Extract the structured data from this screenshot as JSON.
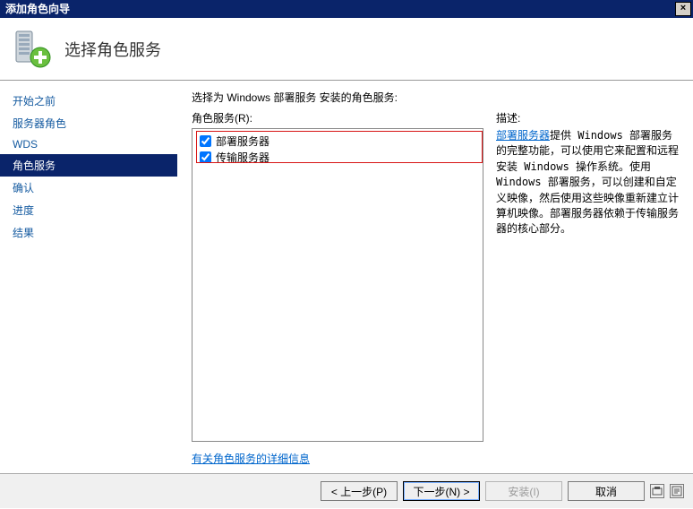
{
  "window": {
    "title": "添加角色向导",
    "close_label": "×"
  },
  "header": {
    "page_title": "选择角色服务"
  },
  "sidebar": {
    "items": [
      {
        "label": "开始之前"
      },
      {
        "label": "服务器角色"
      },
      {
        "label": "WDS"
      },
      {
        "label": "角色服务"
      },
      {
        "label": "确认"
      },
      {
        "label": "进度"
      },
      {
        "label": "结果"
      }
    ],
    "selected_index": 3
  },
  "main": {
    "instruction": "选择为 Windows 部署服务 安装的角色服务:",
    "list_label": "角色服务(R):",
    "roles": [
      {
        "label": "部署服务器",
        "checked": true
      },
      {
        "label": "传输服务器",
        "checked": true
      }
    ],
    "desc_label": "描述:",
    "desc_link": "部署服务器",
    "desc_text": "提供 Windows 部署服务的完整功能，可以使用它来配置和远程安装 Windows 操作系统。使用 Windows 部署服务，可以创建和自定义映像，然后使用这些映像重新建立计算机映像。部署服务器依赖于传输服务器的核心部分。",
    "more_link": "有关角色服务的详细信息"
  },
  "footer": {
    "prev": "< 上一步(P)",
    "next": "下一步(N) >",
    "install": "安装(I)",
    "cancel": "取消"
  }
}
